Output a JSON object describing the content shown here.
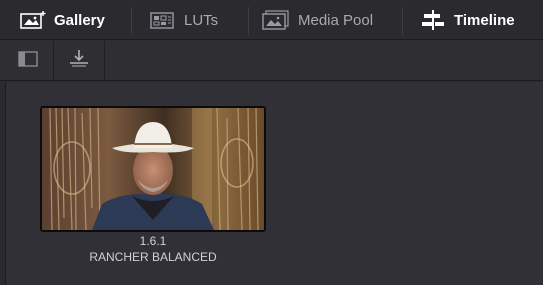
{
  "tabs": [
    {
      "label": "Gallery",
      "icon": "gallery-icon",
      "active": true
    },
    {
      "label": "LUTs",
      "icon": "luts-icon",
      "active": false
    },
    {
      "label": "Media Pool",
      "icon": "media-pool-icon",
      "active": false
    },
    {
      "label": "Timeline",
      "icon": "timeline-icon",
      "active": false
    }
  ],
  "toolbar": {
    "icons": [
      "sidebar-toggle-icon",
      "import-still-icon"
    ]
  },
  "gallery": {
    "still": {
      "number": "1.6.1",
      "label": "RANCHER BALANCED"
    }
  },
  "colors": {
    "active_tab_text": "#ffffff",
    "inactive_tab_text": "#a9a9ae",
    "panel_bg": "#303036"
  }
}
